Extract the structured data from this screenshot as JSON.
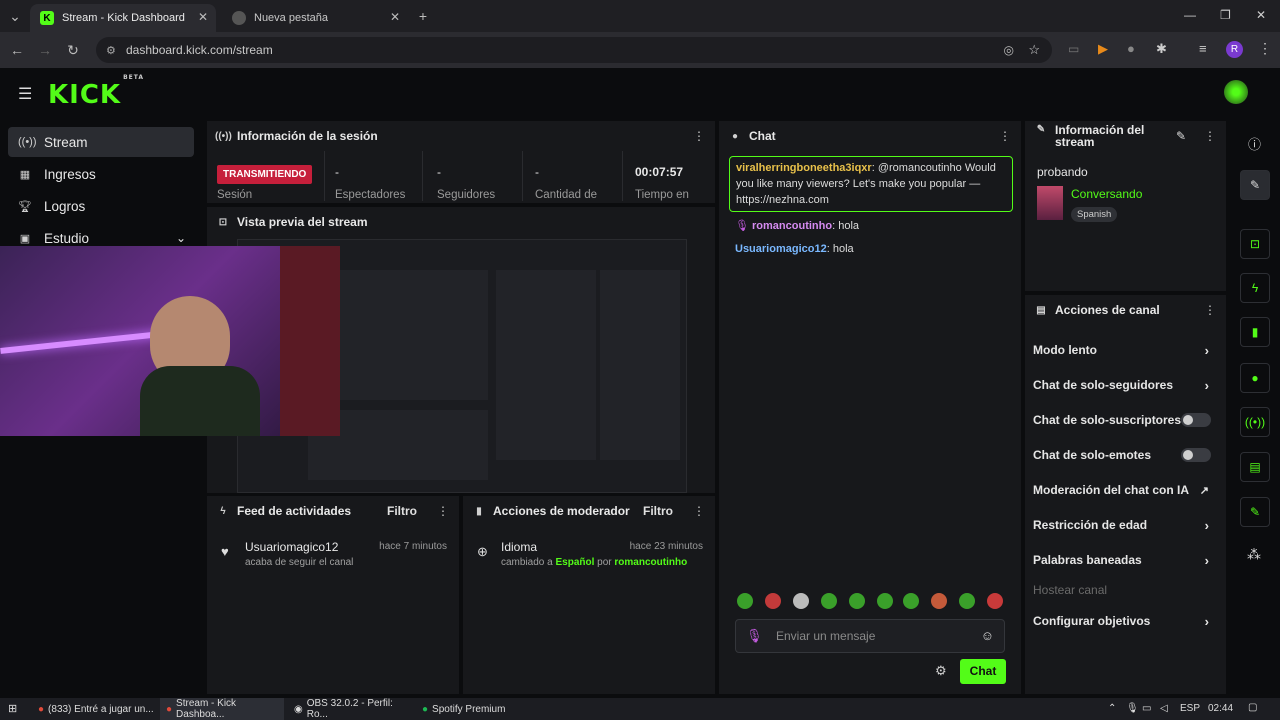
{
  "browser": {
    "tabs": [
      {
        "title": "Stream - Kick Dashboard",
        "active": true
      },
      {
        "title": "Nueva pestaña",
        "active": false
      }
    ],
    "url": "dashboard.kick.com/stream",
    "profile_initial": "R"
  },
  "app": {
    "logo": "KICK",
    "logo_badge": "BETA",
    "sidebar": [
      {
        "label": "Stream",
        "icon": "broadcast-icon",
        "active": true
      },
      {
        "label": "Ingresos",
        "icon": "chart-icon"
      },
      {
        "label": "Logros",
        "icon": "trophy-icon"
      },
      {
        "label": "Estudio",
        "icon": "studio-icon"
      }
    ]
  },
  "session": {
    "title": "Información de la sesión",
    "status": "TRANSMITIENDO",
    "status_label": "Sesión",
    "stats": [
      {
        "value": "-",
        "label": "Espectadores"
      },
      {
        "value": "-",
        "label": "Seguidores"
      },
      {
        "value": "-",
        "label": "Cantidad de"
      },
      {
        "value": "00:07:57",
        "label": "Tiempo en"
      }
    ]
  },
  "preview": {
    "title": "Vista previa del stream"
  },
  "activity": {
    "title": "Feed de actividades",
    "filter": "Filtro",
    "items": [
      {
        "user": "Usuariomagico12",
        "time": "hace 7 minutos",
        "text": "acaba de seguir el canal"
      }
    ]
  },
  "modactions": {
    "title": "Acciones de moderador",
    "filter": "Filtro",
    "items": [
      {
        "title": "Idioma",
        "time": "hace 23 minutos",
        "text_a": "cambiado a",
        "value": "Español",
        "text_b": "por",
        "mod": "romancoutinho"
      }
    ]
  },
  "chat": {
    "title": "Chat",
    "messages": [
      {
        "user": "viralherringboneetha3iqxr",
        "text": "@romancoutinho Would you like many viewers? Let's make you popular — https://nezhna.com",
        "highlight": true
      },
      {
        "user": "romancoutinho",
        "text": "hola"
      },
      {
        "user": "Usuariomagico12",
        "text": "hola"
      }
    ],
    "input_placeholder": "Enviar un mensaje",
    "send_label": "Chat"
  },
  "stream_info": {
    "title": "Información del stream",
    "stream_title": "probando",
    "category": "Conversando",
    "language": "Spanish"
  },
  "channel_actions": {
    "title": "Acciones de canal",
    "items": [
      {
        "label": "Modo lento",
        "control": "chevron"
      },
      {
        "label": "Chat de solo-seguidores",
        "control": "chevron"
      },
      {
        "label": "Chat de solo-suscriptores",
        "control": "toggle"
      },
      {
        "label": "Chat de solo-emotes",
        "control": "toggle"
      },
      {
        "label": "Moderación del chat con IA",
        "control": "external"
      },
      {
        "label": "Restricción de edad",
        "control": "chevron"
      },
      {
        "label": "Palabras baneadas",
        "control": "chevron"
      },
      {
        "label": "Hostear canal",
        "control": "none",
        "disabled": true
      },
      {
        "label": "Configurar objetivos",
        "control": "chevron"
      }
    ]
  },
  "taskbar": {
    "items": [
      {
        "label": "(833) Entré a jugar un..."
      },
      {
        "label": "Stream - Kick Dashboa...",
        "active": true
      },
      {
        "label": "OBS 32.0.2 - Perfil: Ro..."
      },
      {
        "label": "Spotify Premium"
      }
    ],
    "lang": "ESP",
    "time": "02:44"
  },
  "colors": {
    "accent": "#53fc18",
    "live": "#c61f3b",
    "panel": "#17181b"
  }
}
